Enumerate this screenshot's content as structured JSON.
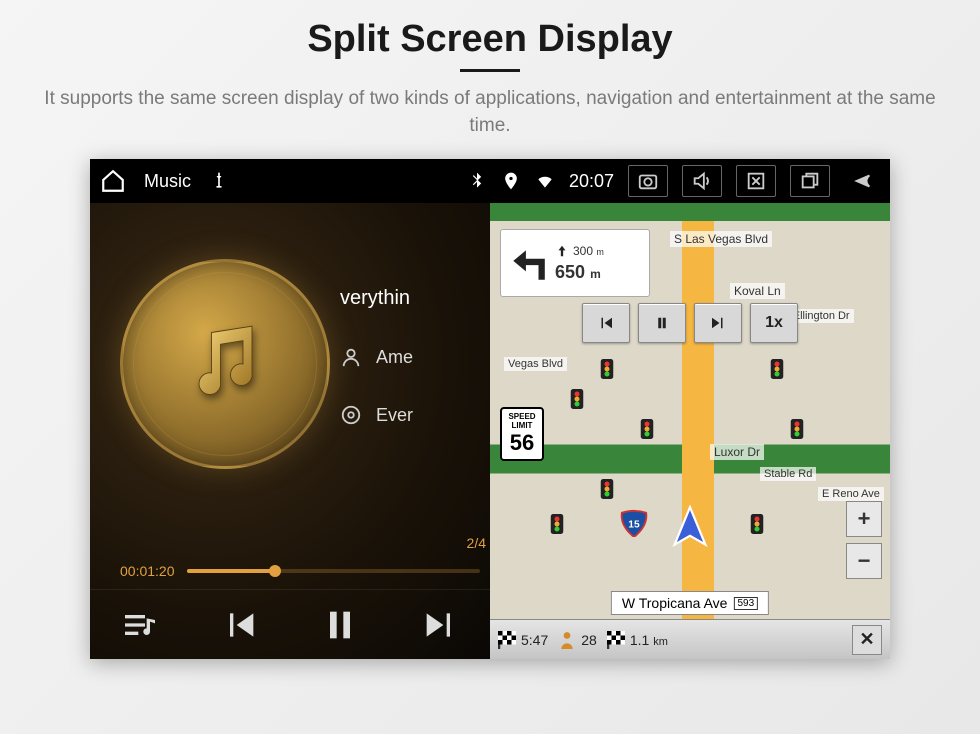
{
  "page": {
    "title": "Split Screen Display",
    "description": "It supports the same screen display of two kinds of applications, navigation and entertainment at the same time."
  },
  "status": {
    "app_title": "Music",
    "time": "20:07"
  },
  "music": {
    "now_playing_truncated": "verythin",
    "artist_truncated": "Ame",
    "album_truncated": "Ever",
    "counter": "2/4",
    "elapsed": "00:01:20",
    "progress_percent": 30
  },
  "nav": {
    "turn_distance": "650",
    "turn_unit": "m",
    "next_distance": "300",
    "next_unit": "m",
    "speed_text": "SPEED",
    "limit_text": "LIMIT",
    "speed_limit": "56",
    "playback_speed": "1x",
    "streets": {
      "top": "S Las Vegas Blvd",
      "koval": "Koval Ln",
      "duke": "Duke Ellington Dr",
      "vegas": "Vegas Blvd",
      "luxor": "Luxor Dr",
      "stable": "Stable Rd",
      "reno": "E Reno Ave",
      "bottom": "W Tropicana Ave"
    },
    "route_badge": "593",
    "eta": "5:47",
    "leg_time": "28",
    "leg_dist": "1.1",
    "leg_dist_unit": "km",
    "zoom_in": "+",
    "zoom_out": "−",
    "close": "✕"
  }
}
